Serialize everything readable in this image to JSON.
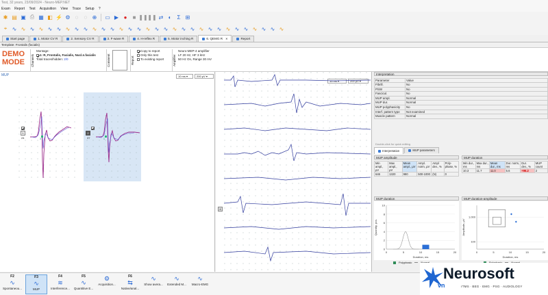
{
  "title": "Test, 32 years, 23/09/2024 - Neuro-MEP.NET",
  "menu": [
    "Exam",
    "Report",
    "Test",
    "Acquisition",
    "View",
    "Trace",
    "Setup",
    "?"
  ],
  "tabs": [
    {
      "label": "Start page"
    },
    {
      "label": "1. Motor CV R"
    },
    {
      "label": "2. Sensory CV R"
    },
    {
      "label": "3. F-wave R"
    },
    {
      "label": "4. H-reflex R"
    },
    {
      "label": "5. Motor inching R"
    },
    {
      "label": "6. QEMG R",
      "active": true
    },
    {
      "label": "Report"
    }
  ],
  "template": "Template: Frontalis (facialis)",
  "demo": {
    "line1": "DEMO",
    "line2": "MODE"
  },
  "channels": {
    "side_label": "Channels",
    "montage_label": "Montage:",
    "montage_value": "1: R, Frontalis, Facialis, Nucl.n.facialis",
    "traces_label": "Total traces/hidden:",
    "traces_value": "2/0"
  },
  "comment": {
    "side_label": "Comment"
  },
  "report": {
    "side_label": "Report",
    "copy_to_report": "Copy to report",
    "only_this_test": "Only this test",
    "to_existing_report": "To existing report"
  },
  "amplifier": {
    "side_label": "Amplifier",
    "name": "Neuro-MEP-4 amplifier",
    "filters": "LF 20 Hz, HF 3 kHz",
    "notch": "50 Hz On, Range 30 mV"
  },
  "mup_panel": {
    "label": "MUP",
    "timebase": "10 ms",
    "sensitivity": "200 µV",
    "mups": [
      {
        "index": "1",
        "amp": "24",
        "marker": "3"
      },
      {
        "index": "2",
        "amp": "37",
        "marker": "1"
      }
    ]
  },
  "raw_panel": {
    "timebase": "10 ms",
    "sensitivity": "200 µV",
    "marker": "4"
  },
  "interpretation": {
    "title": "Interpretation",
    "headers": [
      "Parameter",
      "Value"
    ],
    "rows": [
      [
        "Fibrill.",
        "No"
      ],
      [
        "PSW",
        "No"
      ],
      [
        "Fascicul.",
        "No"
      ],
      [
        "MUP ampl.",
        "Normal"
      ],
      [
        "MUP dur.",
        "Normal"
      ],
      [
        "MUP polyphasicity",
        "No"
      ],
      [
        "Interf. pattern type",
        "Not examined"
      ],
      [
        "Muscle pattern",
        "Normal"
      ]
    ],
    "hint": "Double-click for quick editing",
    "tab1": "Interpretation",
    "tab2": "MUP parameters"
  },
  "mup_amplitude": {
    "title": "MUP amplitude",
    "headers": [
      "Min ampl., µV",
      "Max ampl., µV",
      "Mean ampl., µV",
      "Ampl. norm, µV",
      "Ampl dev., %",
      "Poly-phase, %"
    ],
    "values": [
      "646",
      "1320",
      "980",
      "500-1000",
      "(N)",
      "0"
    ]
  },
  "mup_duration_table": {
    "title": "MUP duration",
    "headers": [
      "Min dur., ms",
      "Max dur., ms",
      "Mean dur., ms",
      "Dur. norm, ms",
      "Dur. dev., %",
      "MUP count"
    ],
    "values": [
      "10.3",
      "11.7",
      "11.0",
      "5.6",
      "+96.2",
      "2"
    ],
    "highlight_color": "#f6c2c2"
  },
  "mup_duration_chart": {
    "title": "MUP duration",
    "ylabel": "Quantity, pcs.",
    "xlabel": "Duration, ms",
    "legend_polyphasic": "Polyphasic",
    "legend_normal": "Normal",
    "xticks": [
      "0",
      "5",
      "10",
      "15",
      "20"
    ],
    "yticks": [
      "0",
      "2",
      "4",
      "6",
      "8",
      "10"
    ]
  },
  "mup_dur_amp_chart": {
    "title": "MUP duration-amplitude",
    "ylabel": "Amplitude, µV",
    "xlabel": "Duration, ms",
    "legend_polyphasic": "Polyphasic",
    "legend_normal": "Normal",
    "yticks": [
      "1,000",
      "100"
    ],
    "xticks": [
      "0",
      "5",
      "10",
      "15",
      "20"
    ]
  },
  "chart_data": [
    {
      "type": "bar",
      "title": "MUP duration",
      "xlabel": "Duration, ms",
      "ylabel": "Quantity, pcs.",
      "xlim": [
        0,
        20
      ],
      "ylim": [
        0,
        10
      ],
      "series": [
        {
          "name": "Normal",
          "x": [
            11,
            12
          ],
          "values": [
            1,
            1
          ]
        }
      ],
      "norm_curve_peak_x": 5.6
    },
    {
      "type": "scatter",
      "title": "MUP duration-amplitude",
      "xlabel": "Duration, ms",
      "ylabel": "Amplitude, µV",
      "xlim": [
        0,
        20
      ],
      "yscale": "log",
      "series": [
        {
          "name": "Normal",
          "x": [
            10.3,
            11.7
          ],
          "y": [
            1320,
            646
          ]
        }
      ]
    }
  ],
  "function_keys": [
    {
      "key": "F2",
      "label": "Spontaneou..."
    },
    {
      "key": "F3",
      "label": "MUP",
      "selected": true
    },
    {
      "key": "F4",
      "label": "Interference..."
    },
    {
      "key": "F5",
      "label": "Quantitive E..."
    },
    {
      "key": "",
      "label": "Acquisition..."
    },
    {
      "key": "F6",
      "label": "Native/anal..."
    },
    {
      "key": "",
      "label": "Show avera..."
    },
    {
      "key": "",
      "label": "Extended M..."
    },
    {
      "key": "",
      "label": "Macro-EMG"
    }
  ],
  "logo": {
    "brand": "Neurosoft",
    "sub": "vn",
    "tagline": "rTMS · BEG · EMG · PSG · AUDIOLOGY"
  }
}
